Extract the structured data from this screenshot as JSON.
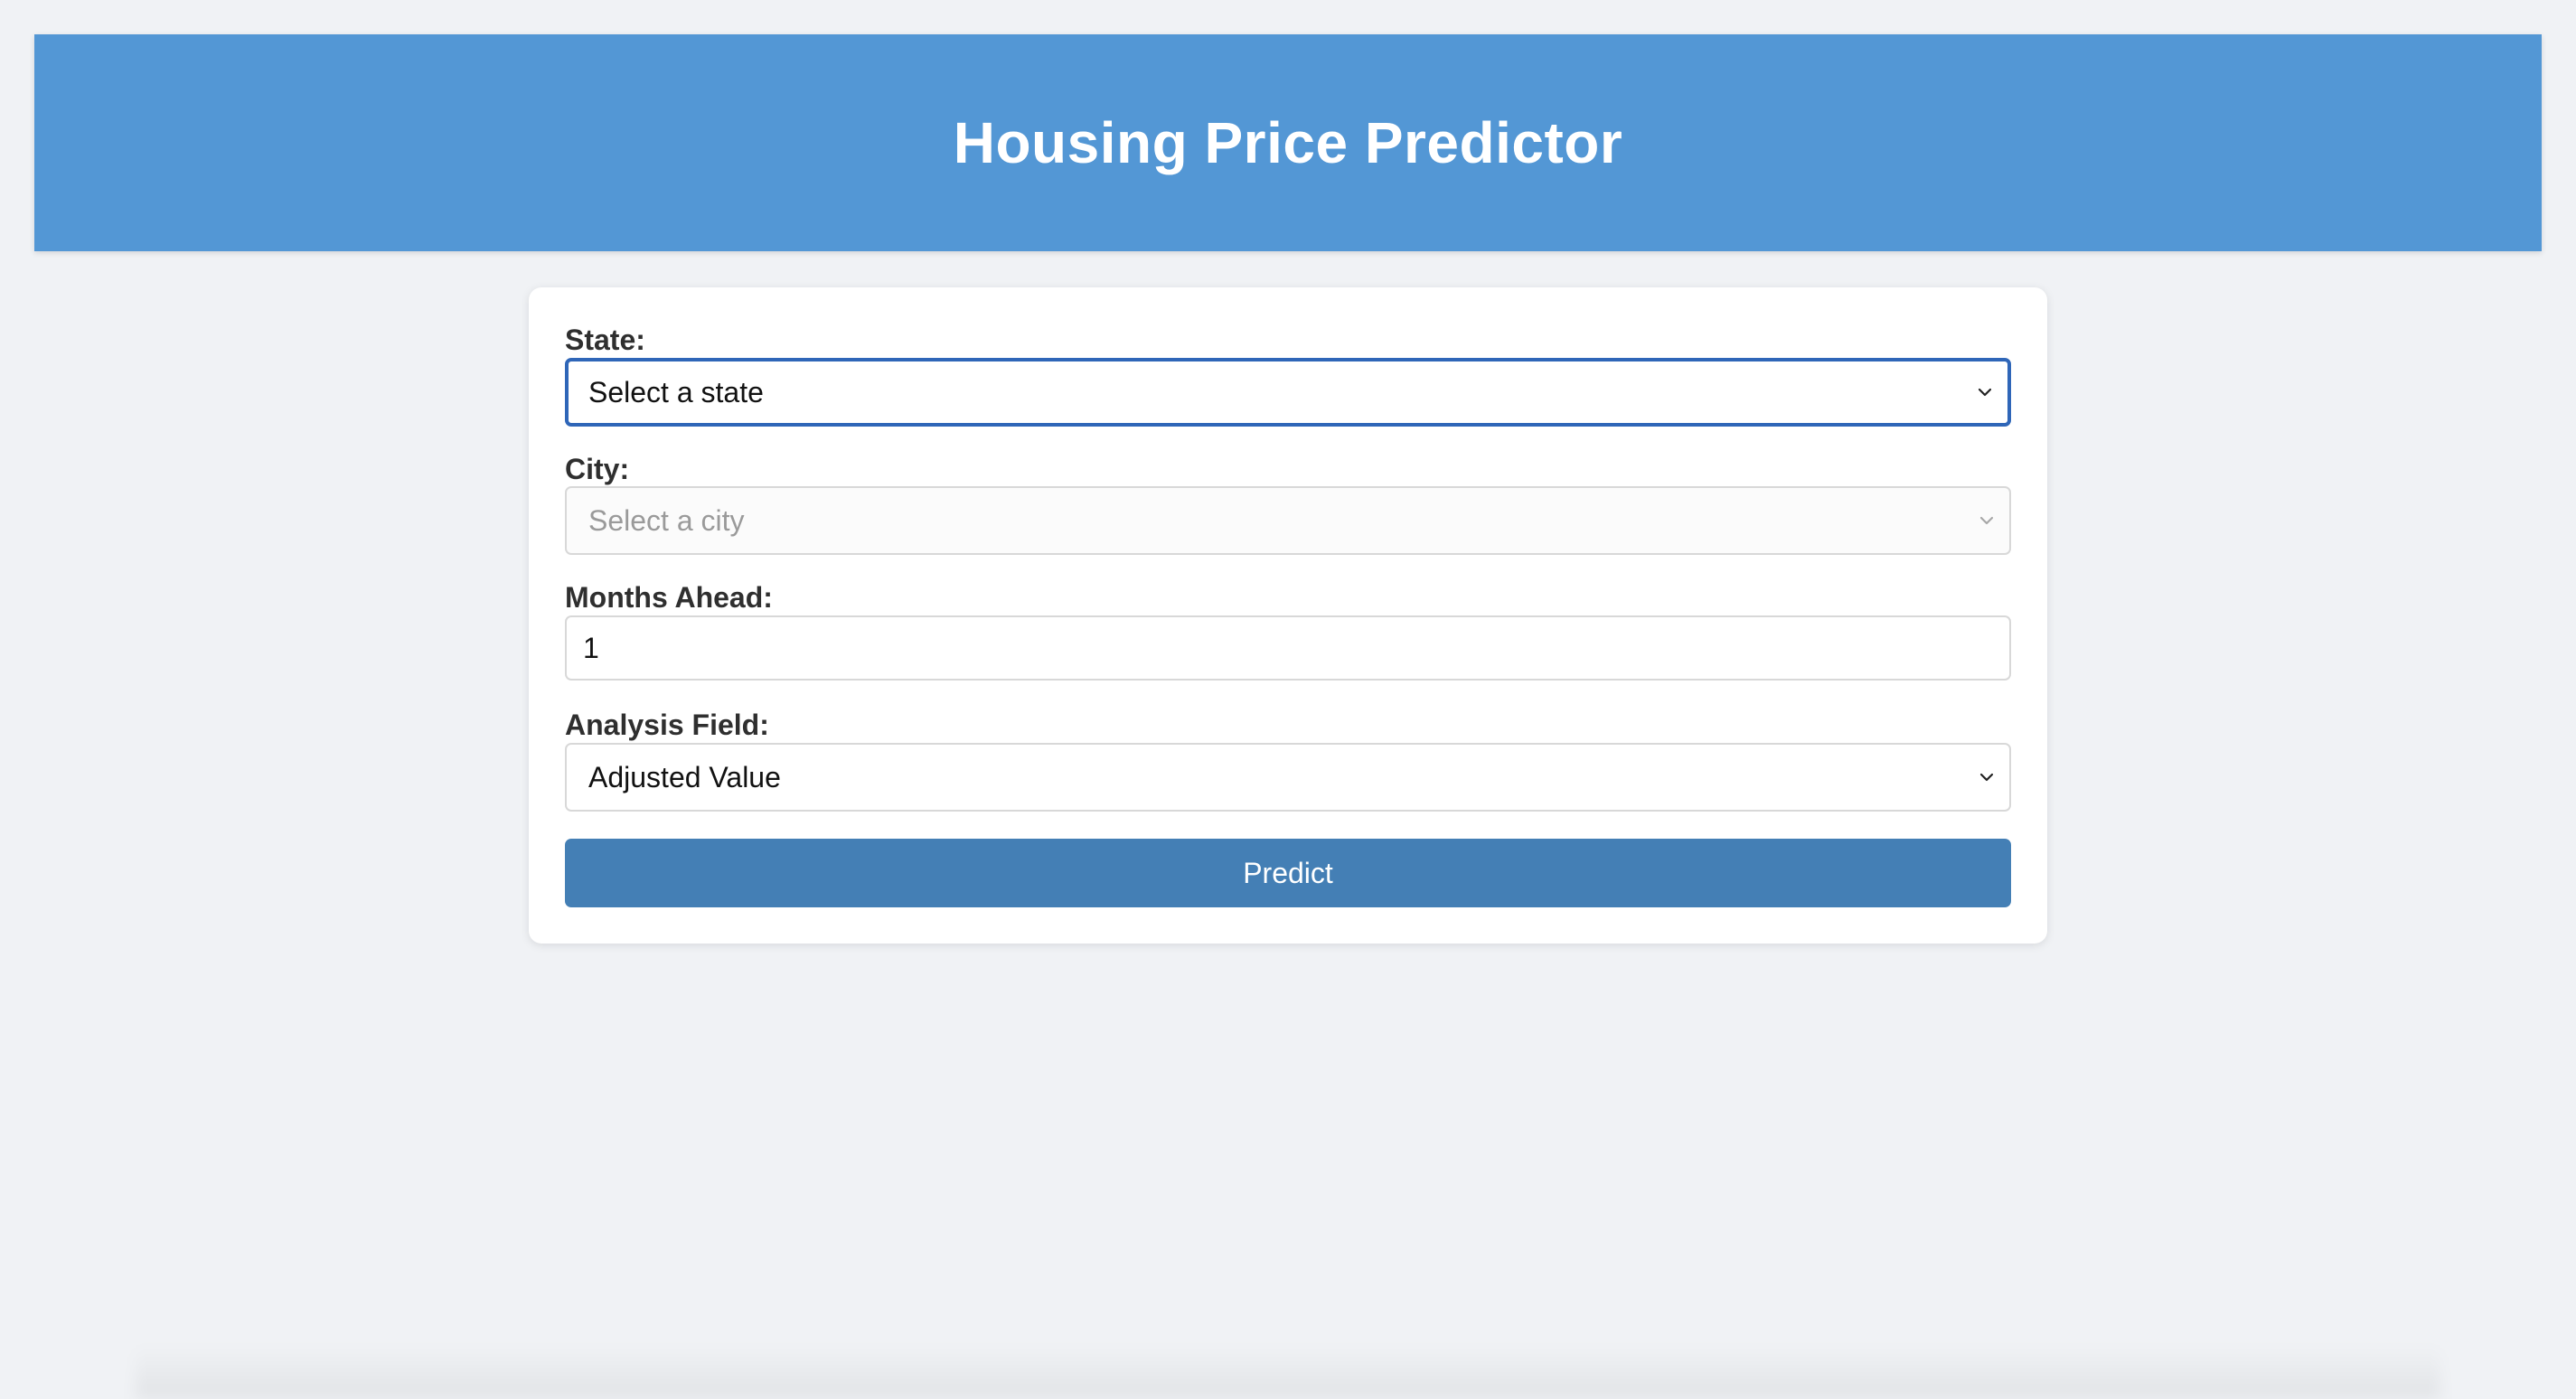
{
  "header": {
    "title": "Housing Price Predictor",
    "color": "#5397d5"
  },
  "form": {
    "state": {
      "label": "State:",
      "selected": "Select a state",
      "icon": "chevron-down-icon"
    },
    "city": {
      "label": "City:",
      "selected": "Select a city",
      "disabled": true,
      "icon": "chevron-down-icon"
    },
    "months_ahead": {
      "label": "Months Ahead:",
      "value": "1"
    },
    "analysis_field": {
      "label": "Analysis Field:",
      "selected": "Adjusted Value",
      "icon": "chevron-down-icon"
    },
    "submit": {
      "label": "Predict",
      "color": "#447fb5"
    }
  },
  "colors": {
    "background": "#f0f2f5",
    "focus_border": "#2f66b8"
  }
}
